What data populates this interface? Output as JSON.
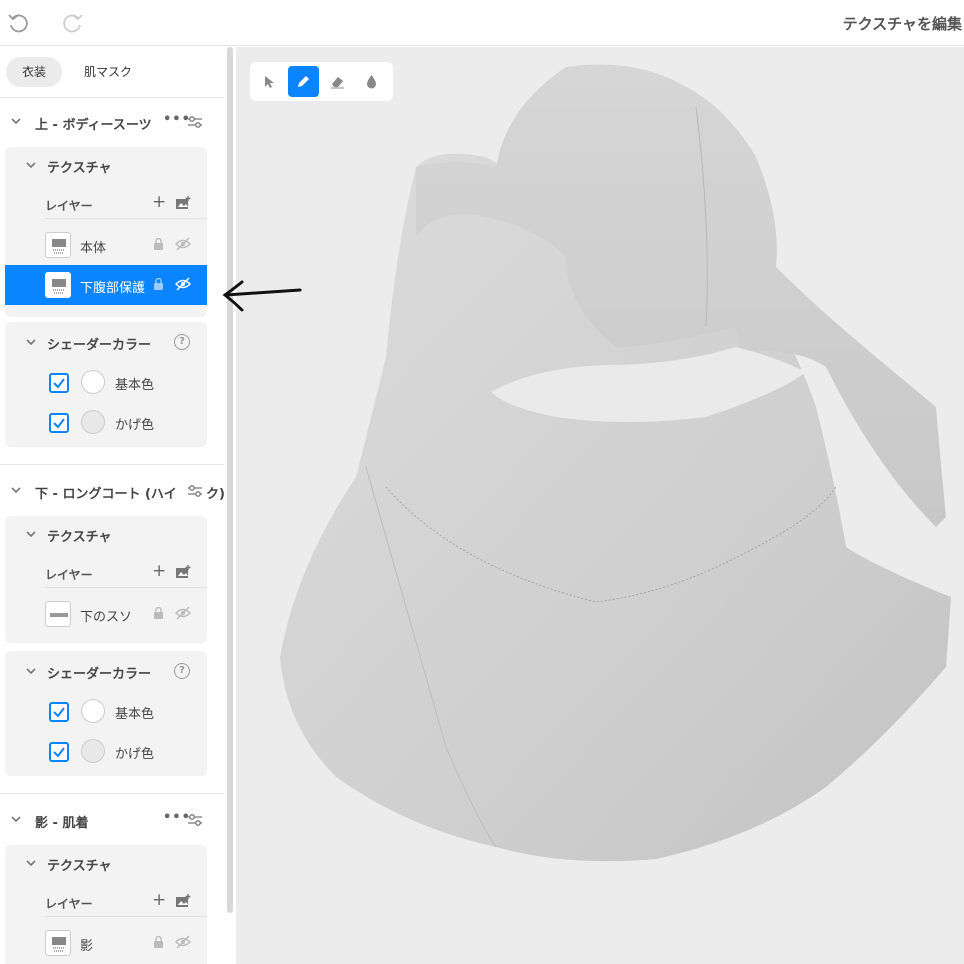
{
  "header": {
    "title": "テクスチャを編集",
    "undo_icon": "undo-icon",
    "redo_icon": "redo-icon"
  },
  "tabs": [
    {
      "label": "衣装",
      "active": true
    },
    {
      "label": "肌マスク",
      "active": false
    }
  ],
  "sections": [
    {
      "title": "上 - ボディースーツ",
      "texture": {
        "heading": "テクスチャ",
        "layers_label": "レイヤー",
        "layers": [
          {
            "name": "本体",
            "selected": false
          },
          {
            "name": "下腹部保護",
            "selected": true
          }
        ]
      },
      "shader": {
        "heading": "シェーダーカラー",
        "rows": [
          {
            "name": "基本色",
            "color": "#ffffff"
          },
          {
            "name": "かげ色",
            "color": "#e8e8e8"
          }
        ]
      }
    },
    {
      "title": "下 - ロングコート (ハイ",
      "title_tail": "ク)",
      "texture": {
        "heading": "テクスチャ",
        "layers_label": "レイヤー",
        "layers": [
          {
            "name": "下のスソ",
            "selected": false
          }
        ]
      },
      "shader": {
        "heading": "シェーダーカラー",
        "rows": [
          {
            "name": "基本色",
            "color": "#ffffff"
          },
          {
            "name": "かげ色",
            "color": "#e8e8e8"
          }
        ]
      }
    },
    {
      "title": "影 - 肌着",
      "texture": {
        "heading": "テクスチャ",
        "layers_label": "レイヤー",
        "layers": [
          {
            "name": "影",
            "selected": false
          }
        ]
      }
    }
  ],
  "toolbar": {
    "tools": [
      "select-tool",
      "pen-tool",
      "eraser-tool",
      "fill-tool"
    ],
    "active": "pen-tool"
  },
  "colors": {
    "accent": "#0a84ff",
    "viewport_bg": "#ececec",
    "model": "#cfcfcf"
  }
}
